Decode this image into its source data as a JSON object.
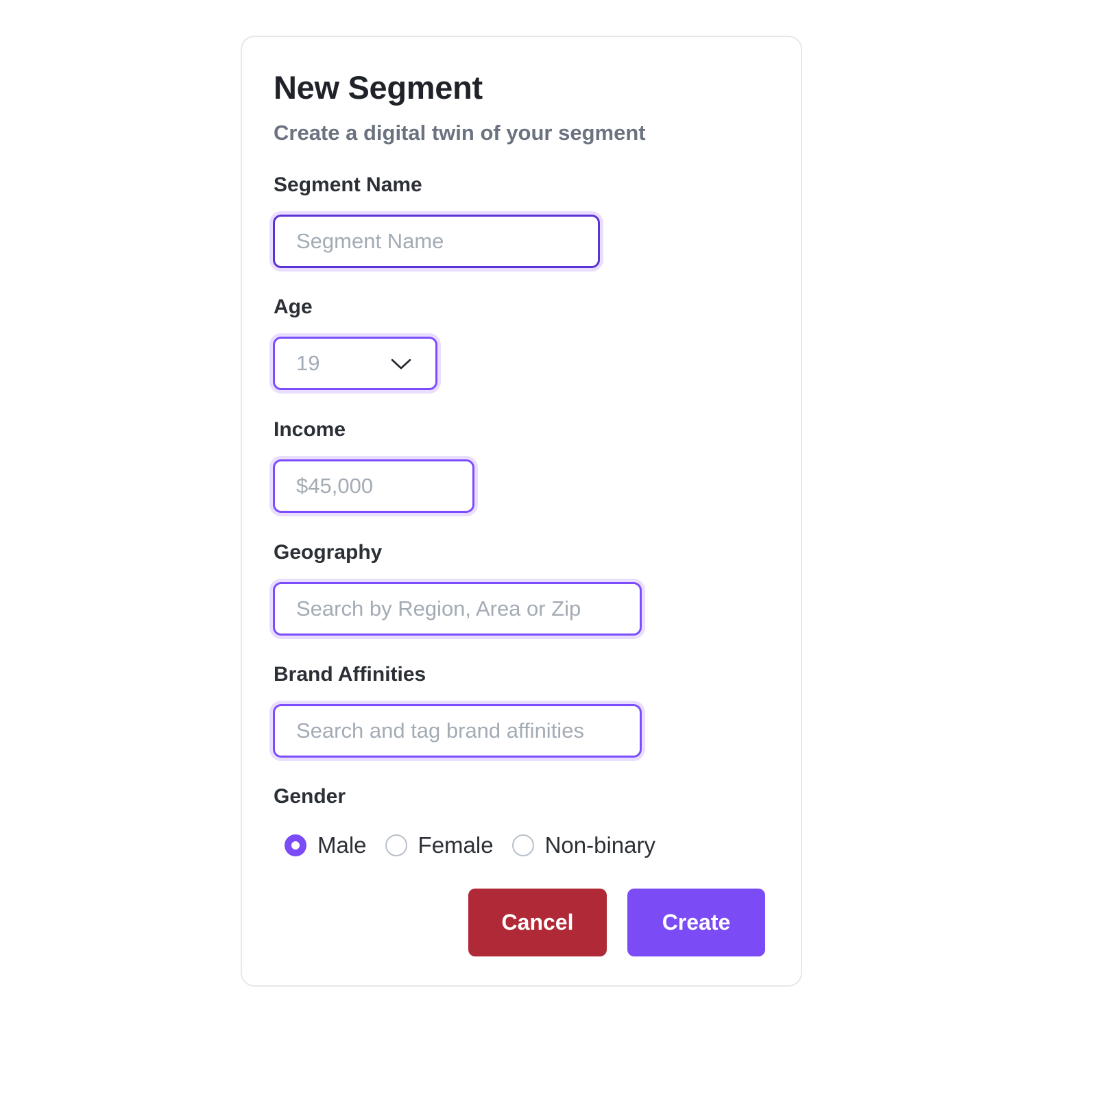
{
  "dialog": {
    "title": "New Segment",
    "subtitle": "Create a digital twin of your segment"
  },
  "fields": {
    "segment_name": {
      "label": "Segment Name",
      "value": "",
      "placeholder": "Segment Name"
    },
    "age": {
      "label": "Age",
      "selected": "19"
    },
    "income": {
      "label": "Income",
      "value": "",
      "placeholder": "$45,000"
    },
    "geography": {
      "label": "Geography",
      "value": "",
      "placeholder": "Search by Region, Area or Zip"
    },
    "brand_affinities": {
      "label": "Brand Affinities",
      "value": "",
      "placeholder": "Search and tag brand affinities"
    },
    "gender": {
      "label": "Gender",
      "options": [
        {
          "label": "Male",
          "checked": true
        },
        {
          "label": "Female",
          "checked": false
        },
        {
          "label": "Non-binary",
          "checked": false
        }
      ]
    }
  },
  "actions": {
    "cancel_label": "Cancel",
    "create_label": "Create"
  },
  "colors": {
    "accent": "#7b4bf5",
    "focus_ring": "#e9defe",
    "cancel": "#b02937",
    "title_text": "#1f2329",
    "subtitle_text": "#6b7280",
    "placeholder_text": "#a3abb5"
  },
  "icons": {
    "age_dropdown": "chevron-down-icon"
  }
}
